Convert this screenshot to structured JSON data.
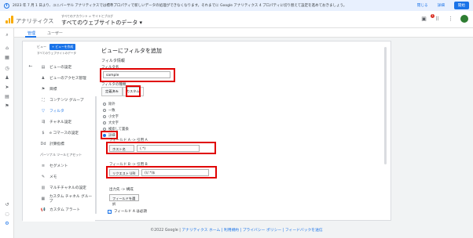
{
  "banner": {
    "message": "2023 年 7 月 1 日より、ユニバーサル アナリティクスでは標準プロパティで新しいデータの処理ができなくなります。それまでに Google アナリティクス 4 プロパティに切り替えて設定を進めておきましょう。",
    "close": "閉じる",
    "details": "詳細",
    "start": "開始"
  },
  "header": {
    "app_name": "アナリティクス",
    "account_sub": "すべてのアカウント > サイトとブログ",
    "account_main": "すべてのウェブサイトのデータ ▾",
    "notif_count": "1"
  },
  "tabs": [
    {
      "label": "管理"
    },
    {
      "label": "ユーザー"
    }
  ],
  "nav": {
    "view_label": "ビュー",
    "create_view": "+ ビューを作成",
    "view_name": "すべてのウェブサイトのデータ",
    "items": [
      {
        "label": "ビューの設定",
        "icon": "doc-icon"
      },
      {
        "label": "ビューのアクセス管理",
        "icon": "people-icon"
      },
      {
        "label": "目標",
        "icon": "flag-icon"
      },
      {
        "label": "コンテンツ グループ",
        "icon": "group-icon"
      },
      {
        "label": "フィルタ",
        "icon": "filter-icon"
      },
      {
        "label": "チャネル設定",
        "icon": "channel-icon"
      },
      {
        "label": "e コマースの設定",
        "icon": "cart-icon"
      },
      {
        "label": "計算指標",
        "icon": "calc-icon"
      }
    ],
    "section": "パーソナル ツールとアセット",
    "items2": [
      {
        "label": "セグメント",
        "icon": "segment-icon"
      },
      {
        "label": "メモ",
        "icon": "note-icon"
      },
      {
        "label": "マルチチャネルの設定",
        "icon": "multichannel-icon"
      },
      {
        "label": "カスタム チャネル グループ",
        "icon": "custom-channel-icon"
      },
      {
        "label": "カスタム アラート",
        "icon": "alert-icon"
      }
    ]
  },
  "form": {
    "title": "ビューにフィルタを追加",
    "section": "フィルタ情報",
    "filter_name_label": "フィルタ名",
    "filter_name_value": "sample",
    "filter_type_label": "フィルタの種類",
    "type_predefined": "定義済み",
    "type_custom": "カスタム",
    "radios": [
      "除外",
      "一致",
      "小文字",
      "大文字",
      "検索して置換",
      "詳細"
    ],
    "field_a_label": "フィールド A -> 引用 A",
    "field_a_select": "ホスト名",
    "field_a_value": "(.*)",
    "field_b_label": "フィールド B -> 引用 B",
    "field_b_select": "リクエスト URI",
    "field_b_value": "(\\/.*)$",
    "output_label": "出力先 -> 構成",
    "output_select": "フィールドを選択",
    "required_label": "フィールド A は必須"
  },
  "footer": {
    "text": "©2022 Google | ",
    "links": "アナリティクス ホーム | 利用規約 | プライバシー ポリシー | フィードバックを送信"
  }
}
